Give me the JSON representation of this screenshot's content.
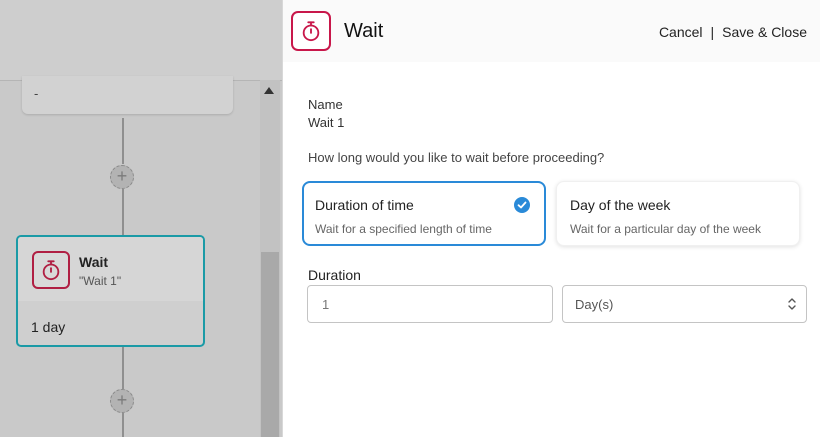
{
  "canvas": {
    "previous_step": {
      "text": "-"
    },
    "wait_node": {
      "title": "Wait",
      "subtitle": "\"Wait 1\"",
      "duration": "1 day"
    }
  },
  "panel": {
    "title": "Wait",
    "icon": "stopwatch-icon",
    "actions": {
      "cancel": "Cancel",
      "separator": "|",
      "save_close": "Save & Close"
    },
    "name_label": "Name",
    "name_value": "Wait 1",
    "question": "How long would you like to wait before proceeding?",
    "options": [
      {
        "title": "Duration of time",
        "description": "Wait for a specified length of time",
        "selected": true
      },
      {
        "title": "Day of the week",
        "description": "Wait for a particular day of the week",
        "selected": false
      }
    ],
    "duration_label": "Duration",
    "duration_value": "1",
    "unit_value": "Day(s)"
  },
  "colors": {
    "accent": "#c8174a",
    "selected": "#2a8ad8",
    "node_border": "#1a9aa6"
  }
}
